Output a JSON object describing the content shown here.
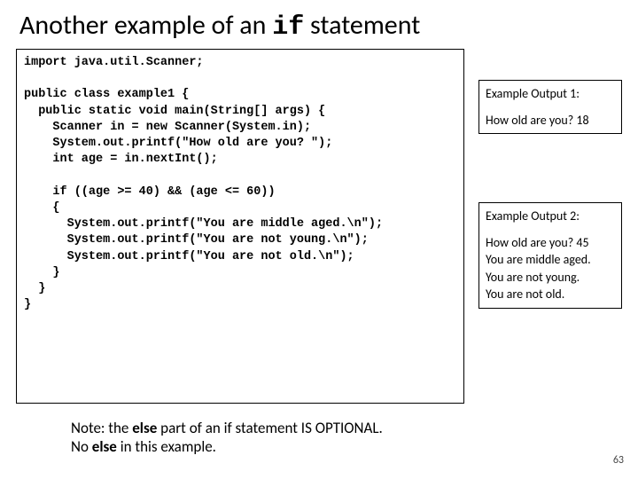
{
  "title": {
    "pre": "Another example of an ",
    "mono": "if",
    "post": " statement"
  },
  "code": "import java.util.Scanner;\n\npublic class example1 {\n  public static void main(String[] args) {\n    Scanner in = new Scanner(System.in);\n    System.out.printf(\"How old are you? \");\n    int age = in.nextInt();\n\n    if ((age >= 40) && (age <= 60))\n    {\n      System.out.printf(\"You are middle aged.\\n\");\n      System.out.printf(\"You are not young.\\n\");\n      System.out.printf(\"You are not old.\\n\");\n    }\n  }\n}",
  "output1": {
    "heading": "Example Output 1:",
    "line1": "How old are you? 18"
  },
  "output2": {
    "heading": "Example Output 2:",
    "line1": "How old are you? 45",
    "line2": "You are middle aged.",
    "line3": "You are not young.",
    "line4": "You are not old."
  },
  "note": {
    "part1": "Note: the ",
    "bold1": "else",
    "part2": " part of an if statement IS OPTIONAL.",
    "part3": "No ",
    "bold2": "else",
    "part4": " in this example."
  },
  "pagenum": "63"
}
